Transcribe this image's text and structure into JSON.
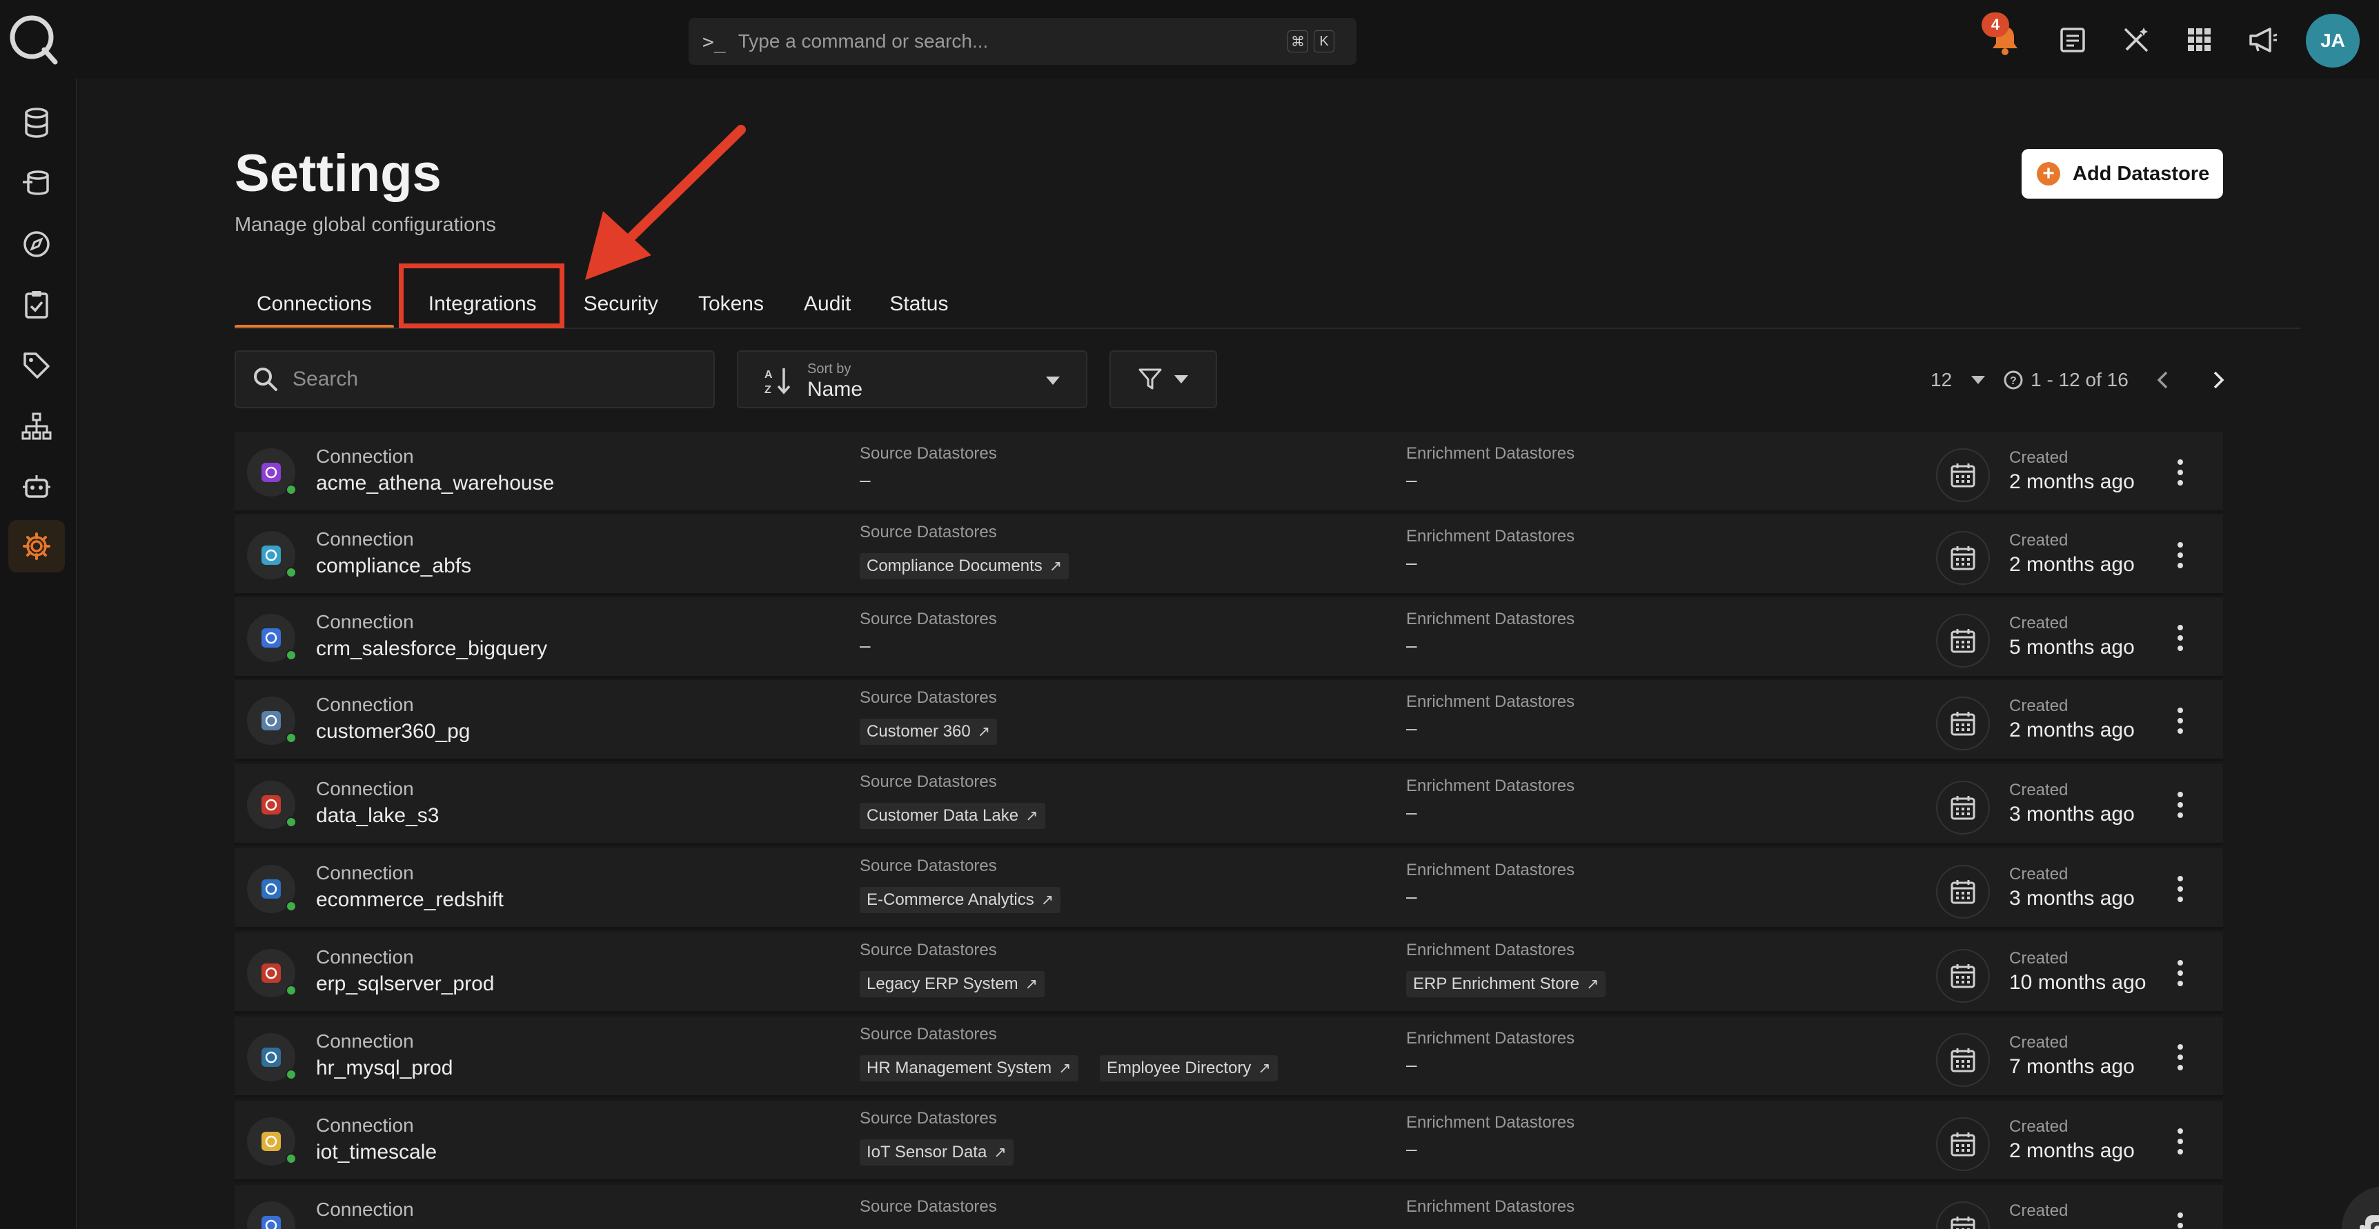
{
  "topbar": {
    "command_placeholder": "Type a command or search...",
    "kbd_cmd": "⌘",
    "kbd_k": "K",
    "notification_count": "4",
    "avatar_initials": "JA"
  },
  "page": {
    "title": "Settings",
    "subtitle": "Manage global configurations",
    "add_button": "Add Datastore"
  },
  "tabs": [
    {
      "label": "Connections",
      "active": true
    },
    {
      "label": "Integrations",
      "active": false
    },
    {
      "label": "Security",
      "active": false
    },
    {
      "label": "Tokens",
      "active": false
    },
    {
      "label": "Audit",
      "active": false
    },
    {
      "label": "Status",
      "active": false
    }
  ],
  "toolbar": {
    "search_placeholder": "Search",
    "sort_label": "Sort by",
    "sort_value": "Name",
    "page_size": "12",
    "range": "1 - 12 of 16"
  },
  "columns": {
    "kind": "Connection",
    "source": "Source Datastores",
    "enrichment": "Enrichment Datastores",
    "created": "Created",
    "empty": "–"
  },
  "rows": [
    {
      "name": "acme_athena_warehouse",
      "icon": "athena-icon",
      "icon_color": "#8b3fd1",
      "source": [],
      "enrichment": [],
      "created": "2 months ago"
    },
    {
      "name": "compliance_abfs",
      "icon": "abfs-icon",
      "icon_color": "#3aa0c8",
      "source": [
        "Compliance Documents"
      ],
      "enrichment": [],
      "created": "2 months ago"
    },
    {
      "name": "crm_salesforce_bigquery",
      "icon": "bigquery-icon",
      "icon_color": "#3b6fd8",
      "source": [],
      "enrichment": [],
      "created": "5 months ago"
    },
    {
      "name": "customer360_pg",
      "icon": "postgres-icon",
      "icon_color": "#5a7fa8",
      "source": [
        "Customer 360"
      ],
      "enrichment": [],
      "created": "2 months ago"
    },
    {
      "name": "data_lake_s3",
      "icon": "s3-icon",
      "icon_color": "#c7392b",
      "source": [
        "Customer Data Lake"
      ],
      "enrichment": [],
      "created": "3 months ago"
    },
    {
      "name": "ecommerce_redshift",
      "icon": "redshift-icon",
      "icon_color": "#2e6fc0",
      "source": [
        "E-Commerce Analytics"
      ],
      "enrichment": [],
      "created": "3 months ago"
    },
    {
      "name": "erp_sqlserver_prod",
      "icon": "sqlserver-icon",
      "icon_color": "#c0392b",
      "source": [
        "Legacy ERP System"
      ],
      "enrichment": [
        "ERP Enrichment Store"
      ],
      "created": "10 months ago"
    },
    {
      "name": "hr_mysql_prod",
      "icon": "mysql-icon",
      "icon_color": "#2f6f9a",
      "source": [
        "HR Management System",
        "Employee Directory"
      ],
      "enrichment": [],
      "created": "7 months ago"
    },
    {
      "name": "iot_timescale",
      "icon": "timescale-icon",
      "icon_color": "#e0b13a",
      "source": [
        "IoT Sensor Data"
      ],
      "enrichment": [],
      "created": "2 months ago"
    },
    {
      "name": "",
      "icon": "database-icon",
      "icon_color": "#3b6fd8",
      "source": [],
      "enrichment": [],
      "created": ""
    }
  ]
}
